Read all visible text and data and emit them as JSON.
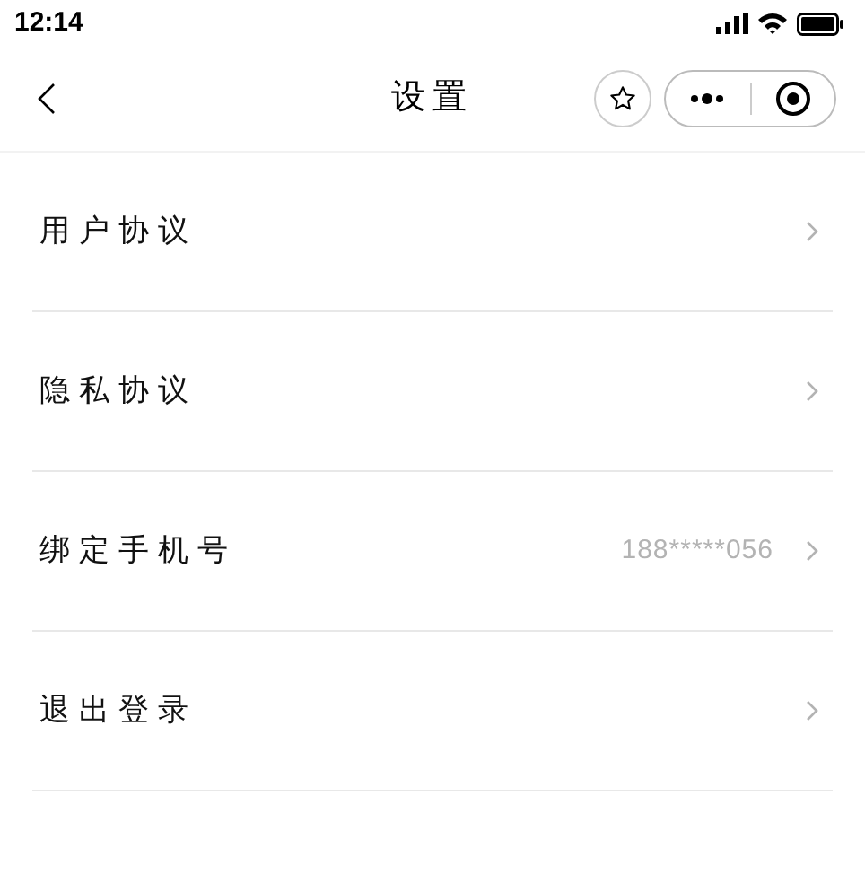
{
  "status_bar": {
    "time": "12:14"
  },
  "nav_bar": {
    "title": "设置"
  },
  "items": [
    {
      "label": "用户协议"
    },
    {
      "label": "隐私协议"
    },
    {
      "label": "绑定手机号",
      "value": "188*****056"
    },
    {
      "label": "退出登录"
    }
  ]
}
